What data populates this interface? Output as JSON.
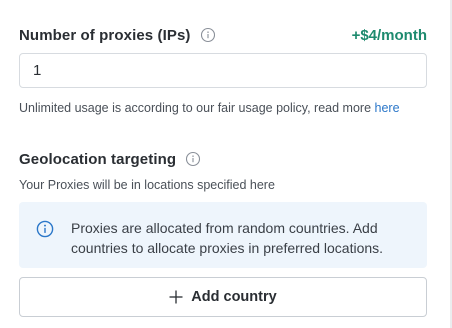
{
  "proxies": {
    "title": "Number of proxies (IPs)",
    "price": "+$4/month",
    "input_value": "1",
    "hint_text": "Unlimited usage is according to our fair usage policy, read more ",
    "hint_link": "here"
  },
  "geolocation": {
    "title": "Geolocation targeting",
    "subtitle": "Your Proxies will be in locations specified here",
    "notice_line1": "Proxies are allocated from random countries. Add",
    "notice_line2": "countries to allocate proxies in preferred locations.",
    "add_button_label": "Add country"
  },
  "colors": {
    "price": "#1d8a6e",
    "link": "#2b77c9",
    "notice_bg": "#eef5fc",
    "notice_icon": "#2b77c9"
  },
  "icons": {
    "info": "info-icon",
    "plus": "plus-icon"
  }
}
